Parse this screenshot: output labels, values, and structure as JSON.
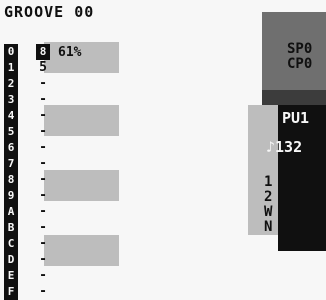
{
  "header": {
    "title": "GROOVE 00"
  },
  "steps": [
    {
      "label": "0",
      "value": "8",
      "bar": true
    },
    {
      "label": "1",
      "value": "5",
      "bar": true
    },
    {
      "label": "2",
      "value": "-",
      "bar": false
    },
    {
      "label": "3",
      "value": "-",
      "bar": false
    },
    {
      "label": "4",
      "value": "-",
      "bar": true
    },
    {
      "label": "5",
      "value": "-",
      "bar": true
    },
    {
      "label": "6",
      "value": "-",
      "bar": false
    },
    {
      "label": "7",
      "value": "-",
      "bar": false
    },
    {
      "label": "8",
      "value": "-",
      "bar": true
    },
    {
      "label": "9",
      "value": "-",
      "bar": true
    },
    {
      "label": "A",
      "value": "-",
      "bar": false
    },
    {
      "label": "B",
      "value": "-",
      "bar": false
    },
    {
      "label": "C",
      "value": "-",
      "bar": true
    },
    {
      "label": "D",
      "value": "-",
      "bar": true
    },
    {
      "label": "E",
      "value": "-",
      "bar": false
    },
    {
      "label": "F",
      "value": "-",
      "bar": false
    }
  ],
  "swing_percent": "61%",
  "side_panel": {
    "sp_label": "SP0",
    "cp_label": "CP0",
    "channel": "PU1",
    "tempo": "♪132",
    "mode_letters": [
      "1",
      "2",
      "W",
      "N"
    ]
  },
  "colors": {
    "bg": "#f7f7f7",
    "dark": "#101010",
    "mid": "#6f6f6f",
    "light": "#bdbdbd"
  }
}
